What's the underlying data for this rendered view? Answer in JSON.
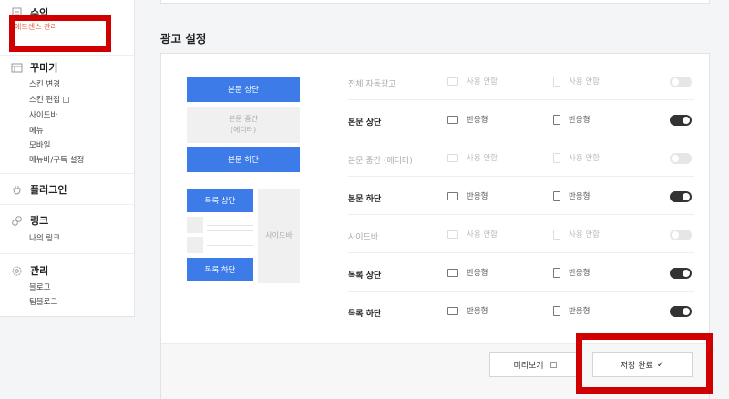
{
  "sidebar": {
    "revenue": {
      "title": "수익",
      "items": [
        "애드센스 관리"
      ]
    },
    "decorate": {
      "title": "꾸미기",
      "items": [
        "스킨 변경",
        "스킨 편집",
        "사이드바",
        "메뉴",
        "모바일",
        "메뉴바/구독 설정"
      ]
    },
    "plugin": {
      "title": "플러그인"
    },
    "link": {
      "title": "링크",
      "items": [
        "나의 링크"
      ]
    },
    "manage": {
      "title": "관리",
      "items": [
        "블로그",
        "팀블로그"
      ]
    }
  },
  "main": {
    "section_title": "광고 설정",
    "preview": {
      "body_top": "본문 상단",
      "body_middle_line1": "본문 중간",
      "body_middle_line2": "(에디터)",
      "body_bottom": "본문 하단",
      "list_top": "목록 상단",
      "list_bottom": "목록 하단",
      "sidebar": "사이드바"
    },
    "rows": [
      {
        "label": "전체 자동광고",
        "enabled": false,
        "pc": "사용 안함",
        "mobile": "사용 안함"
      },
      {
        "label": "본문 상단",
        "enabled": true,
        "pc": "반응형",
        "mobile": "반응형"
      },
      {
        "label": "본문 중간 (에디터)",
        "enabled": false,
        "pc": "사용 안함",
        "mobile": "사용 안함"
      },
      {
        "label": "본문 하단",
        "enabled": true,
        "pc": "반응형",
        "mobile": "반응형"
      },
      {
        "label": "사이드바",
        "enabled": false,
        "pc": "사용 안함",
        "mobile": "사용 안함"
      },
      {
        "label": "목록 상단",
        "enabled": true,
        "pc": "반응형",
        "mobile": "반응형"
      },
      {
        "label": "목록 하단",
        "enabled": true,
        "pc": "반응형",
        "mobile": "반응형"
      }
    ],
    "buttons": {
      "preview": "미리보기",
      "save": "저장 완료"
    }
  },
  "colors": {
    "accent_blue": "#3d7be8",
    "highlight_red": "#d10000",
    "active_link": "#e4572e"
  }
}
